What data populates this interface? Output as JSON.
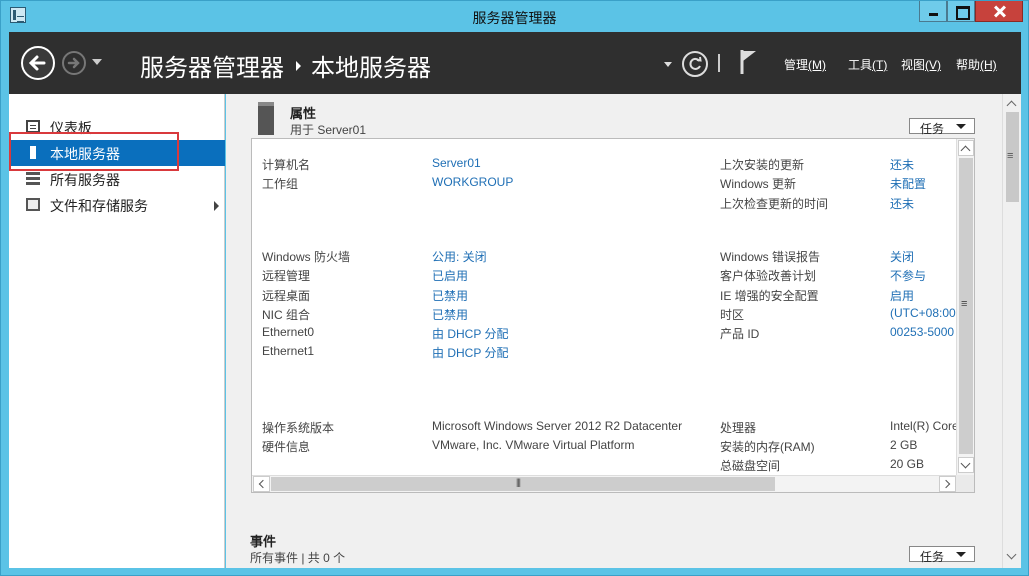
{
  "window": {
    "title": "服务器管理器"
  },
  "header": {
    "breadcrumb": [
      "服务器管理器",
      "本地服务器"
    ],
    "menus": [
      {
        "label": "管理",
        "key": "(M)"
      },
      {
        "label": "工具",
        "key": "(T)"
      },
      {
        "label": "视图",
        "key": "(V)"
      },
      {
        "label": "帮助",
        "key": "(H)"
      }
    ]
  },
  "sidebar": {
    "items": [
      {
        "label": "仪表板",
        "icon": "dashboard-icon"
      },
      {
        "label": "本地服务器",
        "icon": "local-server-icon",
        "active": true
      },
      {
        "label": "所有服务器",
        "icon": "all-servers-icon"
      },
      {
        "label": "文件和存储服务",
        "icon": "file-storage-icon",
        "has_submenu": true
      }
    ]
  },
  "properties": {
    "title": "属性",
    "subtitle": "用于 Server01",
    "tasks_label": "任务",
    "left": [
      {
        "key": "计算机名",
        "value": "Server01",
        "link": true
      },
      {
        "key": "工作组",
        "value": "WORKGROUP",
        "link": true
      },
      {
        "key": "Windows 防火墙",
        "value": "公用: 关闭",
        "link": true
      },
      {
        "key": "远程管理",
        "value": "已启用",
        "link": true
      },
      {
        "key": "远程桌面",
        "value": "已禁用",
        "link": true
      },
      {
        "key": "NIC 组合",
        "value": "已禁用",
        "link": true
      },
      {
        "key": "Ethernet0",
        "value": "由 DHCP 分配",
        "link": true
      },
      {
        "key": "Ethernet1",
        "value": "由 DHCP 分配",
        "link": true
      },
      {
        "key": "操作系统版本",
        "value": "Microsoft Windows Server 2012 R2 Datacenter",
        "link": false
      },
      {
        "key": "硬件信息",
        "value": "VMware, Inc. VMware Virtual Platform",
        "link": false
      }
    ],
    "right": [
      {
        "key": "上次安装的更新",
        "value": "还未",
        "link": true
      },
      {
        "key": "Windows 更新",
        "value": "未配置",
        "link": true
      },
      {
        "key": "上次检查更新的时间",
        "value": "还未",
        "link": true
      },
      {
        "key": "Windows 错误报告",
        "value": "关闭",
        "link": true
      },
      {
        "key": "客户体验改善计划",
        "value": "不参与",
        "link": true
      },
      {
        "key": "IE 增强的安全配置",
        "value": "启用",
        "link": true
      },
      {
        "key": "时区",
        "value": "(UTC+08:00",
        "link": true
      },
      {
        "key": "产品 ID",
        "value": "00253-5000",
        "link": true
      },
      {
        "key": "处理器",
        "value": "Intel(R) Core",
        "link": false
      },
      {
        "key": "安装的内存(RAM)",
        "value": "2 GB",
        "link": false
      },
      {
        "key": "总磁盘空间",
        "value": "20 GB",
        "link": false
      }
    ]
  },
  "events": {
    "title": "事件",
    "subtitle": "所有事件 | 共 0 个",
    "tasks_label": "任务"
  }
}
